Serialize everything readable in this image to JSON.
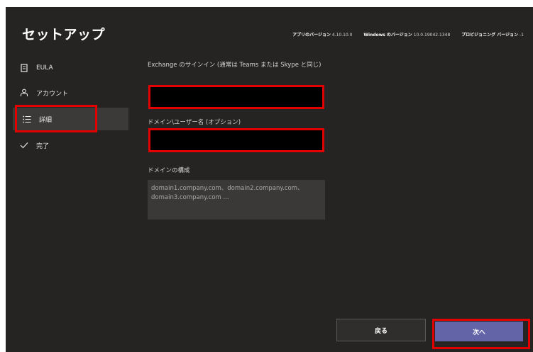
{
  "header": {
    "title": "セットアップ",
    "app_version_label": "アプリのバージョン",
    "app_version_value": "4.10.10.0",
    "windows_version_label": "Windows のバージョン",
    "windows_version_value": "10.0.19042.1348",
    "provisioning_version_label": "プロビジョニング バージョン",
    "provisioning_version_value": "-1"
  },
  "sidebar": {
    "items": [
      {
        "label": "EULA",
        "icon": "document-icon",
        "selected": false
      },
      {
        "label": "アカウント",
        "icon": "person-icon",
        "selected": false
      },
      {
        "label": "詳細",
        "icon": "list-icon",
        "selected": true
      },
      {
        "label": "完了",
        "icon": "checkmark-icon",
        "selected": false
      }
    ]
  },
  "form": {
    "exchange_label": "Exchange のサインイン (通常は Teams または Skype と同じ)",
    "exchange_value": "",
    "domain_user_label": "ドメイン\\ユーザー名 (オプション)",
    "domain_user_value": "",
    "domain_config_label": "ドメインの構成",
    "domain_config_placeholder": "domain1.company.com、domain2.company.com、domain3.company.com ..."
  },
  "footer": {
    "back_label": "戻る",
    "next_label": "次へ"
  },
  "colors": {
    "background": "#252423",
    "selected_nav": "#3b3a39",
    "highlight": "#e30000",
    "primary_button": "#6264a7"
  }
}
